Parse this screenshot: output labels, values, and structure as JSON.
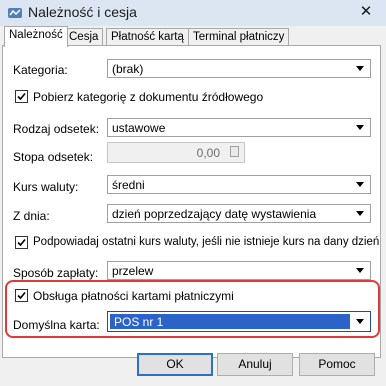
{
  "window": {
    "title": "Należność i cesja",
    "close_glyph": "✕",
    "app_icon": "app-icon"
  },
  "tabs": [
    {
      "label": "Należność",
      "active": true
    },
    {
      "label": "Cesja",
      "active": false
    },
    {
      "label": "Płatność kartą",
      "active": false
    },
    {
      "label": "Terminal płatniczy",
      "active": false
    }
  ],
  "form": {
    "kategoria": {
      "label": "Kategoria:",
      "value": "(brak)"
    },
    "pobierz_kategorie": {
      "label": "Pobierz kategorię z dokumentu źródłowego",
      "checked": true
    },
    "rodzaj_odsetek": {
      "label": "Rodzaj odsetek:",
      "value": "ustawowe"
    },
    "stopa_odsetek": {
      "label": "Stopa odsetek:",
      "value": "0,00",
      "icon": "calculator-icon"
    },
    "kurs_waluty": {
      "label": "Kurs waluty:",
      "value": "średni"
    },
    "z_dnia": {
      "label": "Z dnia:",
      "value": "dzień poprzedzający datę wystawienia"
    },
    "podpowiadaj_kurs": {
      "label": "Podpowiadaj ostatni kurs waluty, jeśli nie istnieje kurs na dany dzień",
      "checked": true
    },
    "sposob_zaplaty": {
      "label": "Sposób zapłaty:",
      "value": "przelew"
    },
    "obsluga_platnosci": {
      "label": "Obsługa płatności kartami płatniczymi",
      "checked": true
    },
    "domyslna_karta": {
      "label": "Domyślna karta:",
      "value": "POS nr 1"
    }
  },
  "buttons": {
    "ok": "OK",
    "cancel": "Anuluj",
    "help": "Pomoc"
  },
  "colors": {
    "highlight": "#e03a3a",
    "selection": "#2b63c8",
    "default_button_border": "#2d70c7"
  }
}
